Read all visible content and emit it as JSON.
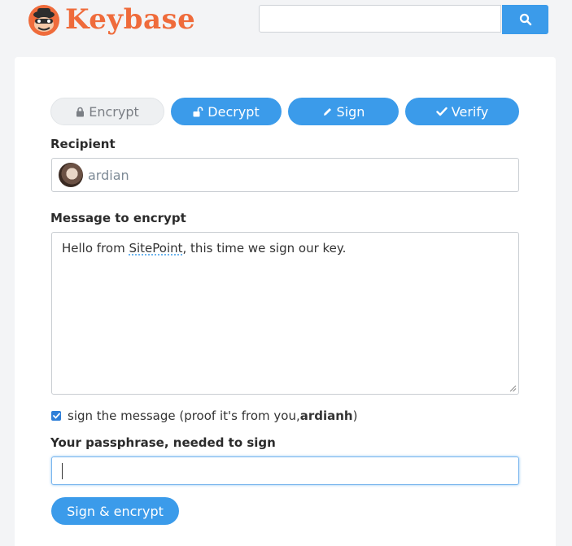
{
  "header": {
    "logo_text": "Keybase",
    "search": {
      "placeholder": "",
      "value": ""
    }
  },
  "tabs": [
    {
      "label": "Encrypt",
      "icon": "lock-icon",
      "active": true
    },
    {
      "label": "Decrypt",
      "icon": "unlock-icon",
      "active": false
    },
    {
      "label": "Sign",
      "icon": "pencil-icon",
      "active": false
    },
    {
      "label": "Verify",
      "icon": "check-icon",
      "active": false
    }
  ],
  "form": {
    "recipient_label": "Recipient",
    "recipient_name": "ardian",
    "message_label": "Message to encrypt",
    "message_before": "Hello from ",
    "message_spell": "SitePoint",
    "message_after": ", this time we sign our key.",
    "sign_checked": true,
    "sign_text": "sign the message (proof it's from you, ",
    "sign_user": "ardianh",
    "sign_close": ")",
    "passphrase_label": "Your passphrase, needed to sign",
    "passphrase_value": "",
    "submit_label": "Sign & encrypt"
  },
  "colors": {
    "accent": "#3b9bea",
    "brand": "#ef6b3b",
    "active_tab_bg": "#eef0f2"
  }
}
